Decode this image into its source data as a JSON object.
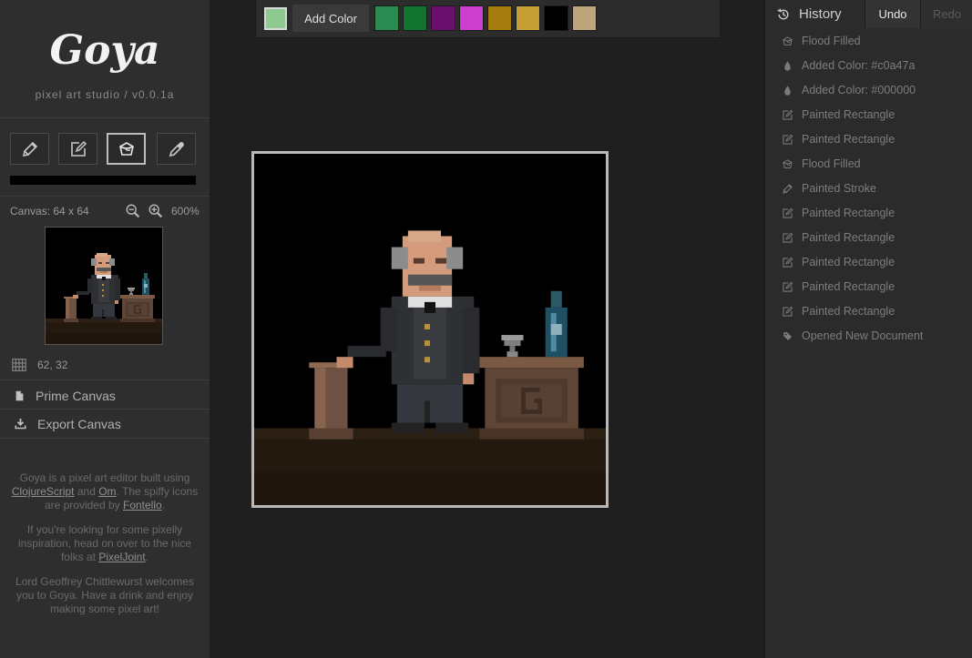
{
  "app": {
    "logo": "Goya",
    "subtitle": "pixel art studio / v0.0.1a"
  },
  "tools": [
    {
      "name": "pencil",
      "icon": "pencil-icon",
      "active": false
    },
    {
      "name": "rectangle",
      "icon": "edit-icon",
      "active": false
    },
    {
      "name": "fill",
      "icon": "paint-bucket-icon",
      "active": true
    },
    {
      "name": "eyedropper",
      "icon": "eyedropper-icon",
      "active": false
    }
  ],
  "canvas_info": {
    "size_label": "Canvas: 64 x 64",
    "zoom": "600%",
    "coords": "62, 32"
  },
  "menu": {
    "prime": "Prime Canvas",
    "export": "Export Canvas"
  },
  "about": {
    "p1_a": "Goya is a pixel art editor built using ",
    "link_clojure": "ClojureScript",
    "p1_b": " and ",
    "link_om": "Om",
    "p1_c": ". The spiffy icons are provided by ",
    "link_fontello": "Fontello",
    "p1_d": ".",
    "p2_a": "If you're looking for some pixelly inspiration, head on over to the nice folks at ",
    "link_pixeljoint": "PixelJoint",
    "p2_b": ".",
    "p3": "Lord Geoffrey Chittlewurst welcomes you to Goya. Have a drink and enjoy making some pixel art!"
  },
  "palette": {
    "current": "#8fc98f",
    "add_label": "Add Color",
    "swatches": [
      "#2a8a52",
      "#11742f",
      "#6b0f6e",
      "#cf3fcf",
      "#a77d10",
      "#c59f34",
      "#000000",
      "#c0a47a"
    ]
  },
  "history": {
    "title": "History",
    "undo": "Undo",
    "redo": "Redo",
    "items": [
      {
        "label": "Flood Filled",
        "icon": "paint-bucket-icon"
      },
      {
        "label": "Added Color: #c0a47a",
        "icon": "droplet-icon"
      },
      {
        "label": "Added Color: #000000",
        "icon": "droplet-icon"
      },
      {
        "label": "Painted Rectangle",
        "icon": "edit-icon"
      },
      {
        "label": "Painted Rectangle",
        "icon": "edit-icon"
      },
      {
        "label": "Flood Filled",
        "icon": "paint-bucket-icon"
      },
      {
        "label": "Painted Stroke",
        "icon": "pencil-icon"
      },
      {
        "label": "Painted Rectangle",
        "icon": "edit-icon"
      },
      {
        "label": "Painted Rectangle",
        "icon": "edit-icon"
      },
      {
        "label": "Painted Rectangle",
        "icon": "edit-icon"
      },
      {
        "label": "Painted Rectangle",
        "icon": "edit-icon"
      },
      {
        "label": "Painted Rectangle",
        "icon": "edit-icon"
      },
      {
        "label": "Opened New Document",
        "icon": "new-doc-icon"
      }
    ]
  }
}
